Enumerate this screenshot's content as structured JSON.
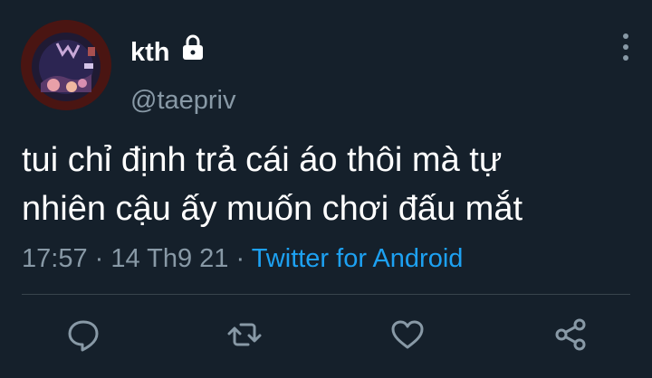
{
  "tweet": {
    "display_name": "kth",
    "handle": "@taepriv",
    "protected_icon": "lock-icon",
    "text_line1": "tui chỉ định trả cái áo thôi mà tự",
    "text_line2": "nhiên cậu ấy muốn chơi đấu mắt",
    "time": "17:57",
    "separator": " · ",
    "date": "14 Th9 21",
    "source": "Twitter for Android"
  },
  "actions": {
    "reply_icon": "reply-icon",
    "retweet_icon": "retweet-icon",
    "like_icon": "heart-icon",
    "share_icon": "share-icon"
  },
  "colors": {
    "background": "#15202b",
    "text": "#ffffff",
    "secondary": "#8899a6",
    "accent": "#1da1f2",
    "divider": "#38444d"
  }
}
